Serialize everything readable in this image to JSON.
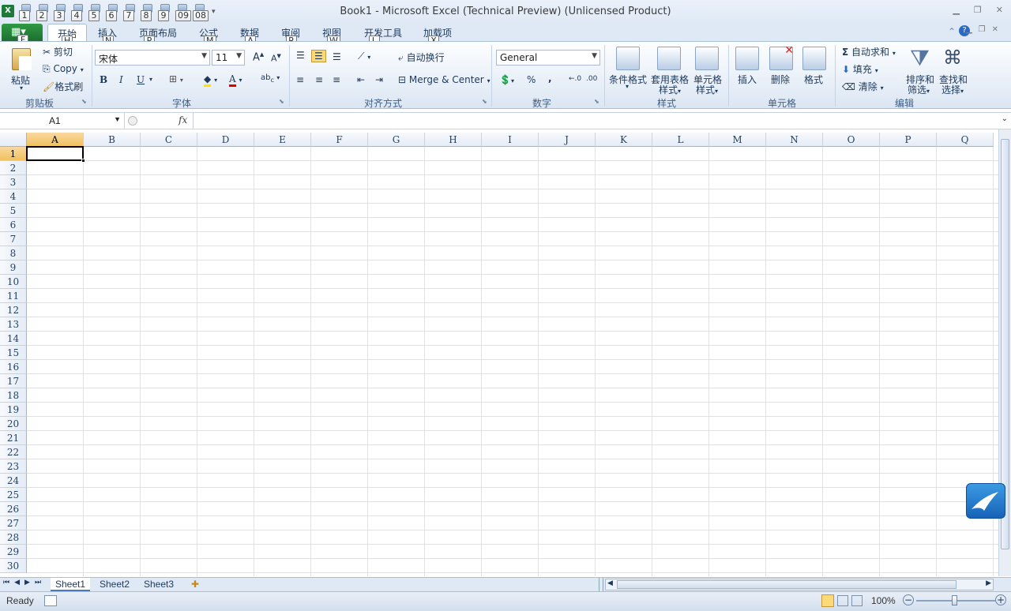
{
  "window": {
    "title": "Book1 - Microsoft Excel (Technical Preview) (Unlicensed Product)"
  },
  "qat": {
    "keytips": [
      "1",
      "2",
      "3",
      "4",
      "5",
      "6",
      "7",
      "8",
      "9",
      "09",
      "08"
    ]
  },
  "ribbon_tabs": [
    {
      "label": "开始",
      "keytip": "H"
    },
    {
      "label": "插入",
      "keytip": "N"
    },
    {
      "label": "页面布局",
      "keytip": "P"
    },
    {
      "label": "公式",
      "keytip": "M"
    },
    {
      "label": "数据",
      "keytip": "A"
    },
    {
      "label": "审阅",
      "keytip": "R"
    },
    {
      "label": "视图",
      "keytip": "W"
    },
    {
      "label": "开发工具",
      "keytip": "L"
    },
    {
      "label": "加载项",
      "keytip": "X"
    }
  ],
  "file_keytip": "F",
  "clipboard": {
    "paste": "粘贴",
    "cut": "剪切",
    "copy": "Copy",
    "format_painter": "格式刷",
    "group": "剪贴板"
  },
  "font": {
    "name": "宋体",
    "size": "11",
    "group": "字体",
    "bold": "B",
    "italic": "I",
    "underline": "U"
  },
  "alignment": {
    "wrap": "自动换行",
    "merge": "Merge & Center",
    "group": "对齐方式"
  },
  "number": {
    "format": "General",
    "percent": "%",
    "comma": ",",
    "group": "数字"
  },
  "styles": {
    "conditional": "条件格式",
    "table1": "套用表格",
    "table2": "样式",
    "cell1": "单元格",
    "cell2": "样式",
    "group": "样式"
  },
  "cells": {
    "insert": "插入",
    "delete": "删除",
    "format": "格式",
    "group": "单元格"
  },
  "editing": {
    "autosum": "自动求和",
    "fill": "填充",
    "clear": "清除",
    "sort1": "排序和",
    "sort2": "筛选",
    "find1": "查找和",
    "find2": "选择",
    "group": "编辑"
  },
  "formula_bar": {
    "name_box": "A1",
    "fx": "fx",
    "value": ""
  },
  "columns": [
    "A",
    "B",
    "C",
    "D",
    "E",
    "F",
    "G",
    "H",
    "I",
    "J",
    "K",
    "L",
    "M",
    "N",
    "O",
    "P",
    "Q"
  ],
  "rows": [
    "1",
    "2",
    "3",
    "4",
    "5",
    "6",
    "7",
    "8",
    "9",
    "10",
    "11",
    "12",
    "13",
    "14",
    "15",
    "16",
    "17",
    "18",
    "19",
    "20",
    "21",
    "22",
    "23",
    "24",
    "25",
    "26",
    "27",
    "28",
    "29",
    "30"
  ],
  "sheets": [
    "Sheet1",
    "Sheet2",
    "Sheet3"
  ],
  "status": {
    "ready": "Ready",
    "zoom": "100%"
  }
}
